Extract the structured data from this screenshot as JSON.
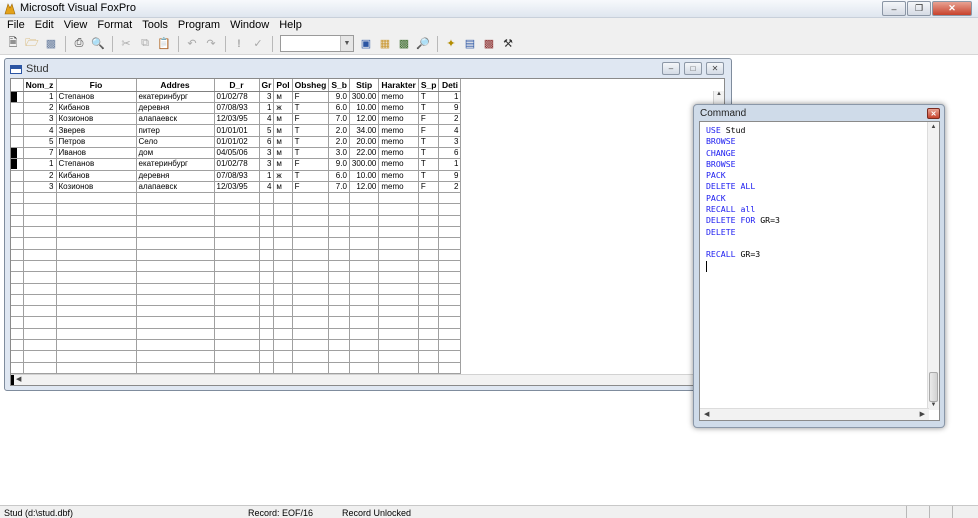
{
  "app": {
    "title": "Microsoft Visual FoxPro"
  },
  "menu": [
    "File",
    "Edit",
    "View",
    "Format",
    "Tools",
    "Program",
    "Window",
    "Help"
  ],
  "toolbar": {
    "icons": [
      "new-file-icon",
      "open-folder-icon",
      "save-icon",
      "print-icon",
      "print-preview-icon",
      "cut-icon",
      "copy-icon",
      "paste-icon",
      "undo-icon",
      "redo-icon",
      "run-icon",
      "modify-form-icon",
      "combo-box",
      "data-session-icon",
      "command-window-icon",
      "properties-icon",
      "code-window-icon",
      "wizard-icon",
      "form-designer-icon",
      "class-browser-icon",
      "tools-icon"
    ],
    "combo_value": ""
  },
  "browse": {
    "title": "Stud",
    "columns": [
      "Nom_z",
      "Fio",
      "Addres",
      "D_r",
      "Gr",
      "Pol",
      "Obsheg",
      "S_b",
      "Stip",
      "Harakter",
      "S_p",
      "Deti"
    ],
    "rows": [
      {
        "sel": true,
        "nom": "1",
        "fio": "Степанов",
        "addr": "екатеринбург",
        "dr": "01/02/78",
        "gr": "3",
        "pol": "м",
        "obsh": "F",
        "sb": "9.0",
        "stip": "300.00",
        "har": "memo",
        "sp": "T",
        "deti": "1"
      },
      {
        "sel": false,
        "nom": "2",
        "fio": "Кибанов",
        "addr": "деревня",
        "dr": "07/08/93",
        "gr": "1",
        "pol": "ж",
        "obsh": "T",
        "sb": "6.0",
        "stip": "10.00",
        "har": "memo",
        "sp": "T",
        "deti": "9"
      },
      {
        "sel": false,
        "nom": "3",
        "fio": "Козионов",
        "addr": "алапаевск",
        "dr": "12/03/95",
        "gr": "4",
        "pol": "м",
        "obsh": "F",
        "sb": "7.0",
        "stip": "12.00",
        "har": "memo",
        "sp": "F",
        "deti": "2"
      },
      {
        "sel": false,
        "nom": "4",
        "fio": "Зверев",
        "addr": "питер",
        "dr": "01/01/01",
        "gr": "5",
        "pol": "м",
        "obsh": "T",
        "sb": "2.0",
        "stip": "34.00",
        "har": "memo",
        "sp": "F",
        "deti": "4"
      },
      {
        "sel": false,
        "nom": "5",
        "fio": "Петров",
        "addr": "Село",
        "dr": "01/01/02",
        "gr": "6",
        "pol": "м",
        "obsh": "T",
        "sb": "2.0",
        "stip": "20.00",
        "har": "memo",
        "sp": "T",
        "deti": "3"
      },
      {
        "sel": true,
        "nom": "7",
        "fio": "Иванов",
        "addr": "дом",
        "dr": "04/05/06",
        "gr": "3",
        "pol": "м",
        "obsh": "T",
        "sb": "3.0",
        "stip": "22.00",
        "har": "memo",
        "sp": "T",
        "deti": "6"
      },
      {
        "sel": true,
        "nom": "1",
        "fio": "Степанов",
        "addr": "екатеринбург",
        "dr": "01/02/78",
        "gr": "3",
        "pol": "м",
        "obsh": "F",
        "sb": "9.0",
        "stip": "300.00",
        "har": "memo",
        "sp": "T",
        "deti": "1"
      },
      {
        "sel": false,
        "nom": "2",
        "fio": "Кибанов",
        "addr": "деревня",
        "dr": "07/08/93",
        "gr": "1",
        "pol": "ж",
        "obsh": "T",
        "sb": "6.0",
        "stip": "10.00",
        "har": "memo",
        "sp": "T",
        "deti": "9"
      },
      {
        "sel": false,
        "nom": "3",
        "fio": "Козионов",
        "addr": "алапаевск",
        "dr": "12/03/95",
        "gr": "4",
        "pol": "м",
        "obsh": "F",
        "sb": "7.0",
        "stip": "12.00",
        "har": "memo",
        "sp": "F",
        "deti": "2"
      }
    ]
  },
  "command": {
    "title": "Command",
    "lines": [
      {
        "kw": "USE",
        "rest": " Stud"
      },
      {
        "kw": "BROWSE",
        "rest": ""
      },
      {
        "kw": "CHANGE",
        "rest": ""
      },
      {
        "kw": "BROWSE",
        "rest": ""
      },
      {
        "kw": "PACK",
        "rest": ""
      },
      {
        "kw": "DELETE ALL",
        "rest": ""
      },
      {
        "kw": "PACK",
        "rest": ""
      },
      {
        "kw": "RECALL all",
        "rest": ""
      },
      {
        "kw": "DELETE FOR",
        "rest": " GR=3"
      },
      {
        "kw": "DELETE",
        "rest": ""
      },
      {
        "kw": "",
        "rest": ""
      },
      {
        "kw": "RECALL",
        "rest": " GR=3"
      }
    ]
  },
  "status": {
    "file": "Stud (d:\\stud.dbf)",
    "record": "Record: EOF/16",
    "lock": "Record Unlocked"
  },
  "colors": {
    "keyword": "#1c1cf0",
    "window_frame": "#dfe7f2"
  }
}
